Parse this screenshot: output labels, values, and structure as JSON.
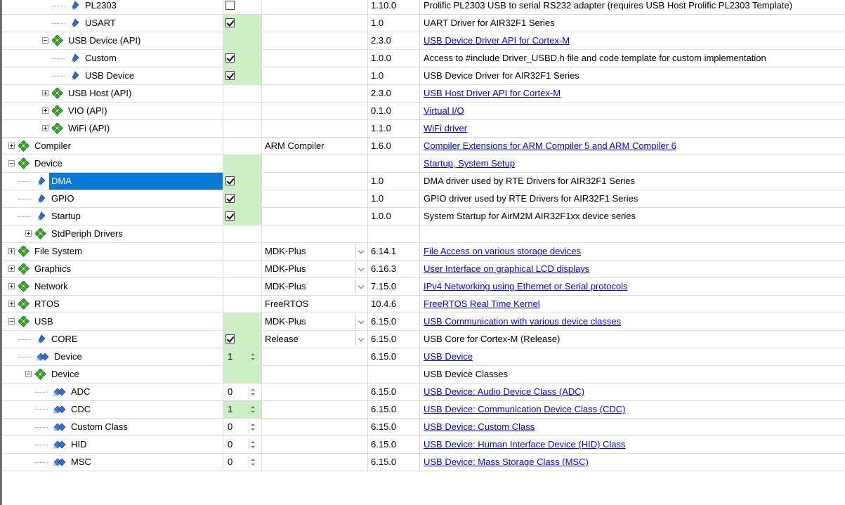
{
  "rows": [
    {
      "name": "PL2303",
      "depth": 3,
      "icon": "blue-diamond-icon",
      "sel": {
        "kind": "checkbox",
        "checked": false
      },
      "variant": "",
      "version": "1.10.0",
      "desc": "Prolific PL2303 USB to serial RS232 adapter (requires USB Host Prolific PL2303 Template)",
      "link": false
    },
    {
      "name": "USART",
      "depth": 3,
      "icon": "blue-diamond-icon",
      "sel": {
        "kind": "checkbox",
        "checked": true
      },
      "variant": "",
      "version": "1.0",
      "desc": "UART Driver for AIR32F1 Series",
      "link": false
    },
    {
      "name": "USB Device (API)",
      "depth": 2,
      "icon": "green-diamond-icon",
      "expander": "minus",
      "sel": {
        "kind": "green"
      },
      "variant": "",
      "version": "2.3.0",
      "desc": "USB Device Driver API for Cortex-M",
      "link": true
    },
    {
      "name": "Custom",
      "depth": 3,
      "icon": "blue-diamond-icon",
      "sel": {
        "kind": "checkbox",
        "checked": true
      },
      "variant": "",
      "version": "1.0.0",
      "desc": "Access to #include Driver_USBD.h file and code template for custom implementation",
      "link": false
    },
    {
      "name": "USB Device",
      "depth": 3,
      "icon": "blue-diamond-icon",
      "sel": {
        "kind": "checkbox",
        "checked": true
      },
      "variant": "",
      "version": "1.0",
      "desc": "USB Device Driver for AIR32F1 Series",
      "link": false
    },
    {
      "name": "USB Host (API)",
      "depth": 2,
      "icon": "green-diamond-icon",
      "expander": "plus",
      "sel": {
        "kind": "none"
      },
      "variant": "",
      "version": "2.3.0",
      "desc": "USB Host Driver API for Cortex-M",
      "link": true
    },
    {
      "name": "VIO (API)",
      "depth": 2,
      "icon": "green-diamond-icon",
      "expander": "plus",
      "sel": {
        "kind": "none"
      },
      "variant": "",
      "version": "0.1.0",
      "desc": "Virtual I/O",
      "link": true
    },
    {
      "name": "WiFi (API)",
      "depth": 2,
      "icon": "green-diamond-icon",
      "expander": "plus",
      "sel": {
        "kind": "none"
      },
      "variant": "",
      "version": "1.1.0",
      "desc": "WiFi driver",
      "link": true
    },
    {
      "name": "Compiler",
      "depth": 0,
      "icon": "green-diamond-icon",
      "expander": "plus",
      "sel": {
        "kind": "none"
      },
      "variant": "ARM Compiler",
      "dropdown": false,
      "version": "1.6.0",
      "desc": "Compiler Extensions for ARM Compiler 5 and ARM Compiler 6",
      "link": true
    },
    {
      "name": "Device",
      "depth": 0,
      "icon": "green-diamond-icon",
      "expander": "minus",
      "sel": {
        "kind": "green"
      },
      "variant": "",
      "version": "",
      "desc": "Startup, System Setup",
      "link": true
    },
    {
      "name": "DMA",
      "depth": 1,
      "icon": "blue-diamond-icon",
      "selected": true,
      "sel": {
        "kind": "checkbox",
        "checked": true
      },
      "variant": "",
      "version": "1.0",
      "desc": "DMA driver used by RTE Drivers for AIR32F1 Series",
      "link": false
    },
    {
      "name": "GPIO",
      "depth": 1,
      "icon": "blue-diamond-icon",
      "sel": {
        "kind": "checkbox",
        "checked": true
      },
      "variant": "",
      "version": "1.0",
      "desc": "GPIO driver used by RTE Drivers for AIR32F1 Series",
      "link": false
    },
    {
      "name": "Startup",
      "depth": 1,
      "icon": "blue-diamond-icon",
      "sel": {
        "kind": "checkbox",
        "checked": true
      },
      "variant": "",
      "version": "1.0.0",
      "desc": "System Startup for AirM2M AIR32F1xx device series",
      "link": false
    },
    {
      "name": "StdPeriph Drivers",
      "depth": 1,
      "icon": "green-diamond-icon",
      "expander": "plus",
      "sel": {
        "kind": "none"
      },
      "variant": "",
      "version": "",
      "desc": "",
      "link": false
    },
    {
      "name": "File System",
      "depth": 0,
      "icon": "green-diamond-icon",
      "expander": "plus",
      "sel": {
        "kind": "none"
      },
      "variant": "MDK-Plus",
      "dropdown": true,
      "version": "6.14.1",
      "desc": "File Access on various storage devices",
      "link": true
    },
    {
      "name": "Graphics",
      "depth": 0,
      "icon": "green-diamond-icon",
      "expander": "plus",
      "sel": {
        "kind": "none"
      },
      "variant": "MDK-Plus",
      "dropdown": true,
      "version": "6.16.3",
      "desc": "User Interface on graphical LCD displays",
      "link": true
    },
    {
      "name": "Network",
      "depth": 0,
      "icon": "green-diamond-icon",
      "expander": "plus",
      "sel": {
        "kind": "none"
      },
      "variant": "MDK-Plus",
      "dropdown": true,
      "version": "7.15.0",
      "desc": "IPv4 Networking using Ethernet or Serial protocols",
      "link": true
    },
    {
      "name": "RTOS",
      "depth": 0,
      "icon": "green-diamond-icon",
      "expander": "plus",
      "sel": {
        "kind": "none"
      },
      "variant": "FreeRTOS",
      "dropdown": false,
      "version": "10.4.6",
      "desc": "FreeRTOS Real Time Kernel",
      "link": true
    },
    {
      "name": "USB",
      "depth": 0,
      "icon": "green-diamond-icon",
      "expander": "minus",
      "sel": {
        "kind": "green"
      },
      "variant": "MDK-Plus",
      "dropdown": true,
      "version": "6.15.0",
      "desc": "USB Communication with various device classes",
      "link": true
    },
    {
      "name": "CORE",
      "depth": 1,
      "icon": "blue-diamond-icon",
      "sel": {
        "kind": "checkbox",
        "checked": true
      },
      "variant": "Release",
      "dropdown": true,
      "version": "6.15.0",
      "desc": "USB Core for Cortex-M (Release)",
      "link": false
    },
    {
      "name": "Device",
      "depth": 1,
      "icon": "multi-diamond-icon",
      "sel": {
        "kind": "spin",
        "value": "1",
        "green": true
      },
      "variant": "",
      "version": "6.15.0",
      "desc": "USB Device",
      "link": true
    },
    {
      "name": "Device",
      "depth": 1,
      "icon": "green-diamond-icon",
      "expander": "minus",
      "sel": {
        "kind": "green"
      },
      "variant": "",
      "version": "",
      "desc": "USB Device Classes",
      "link": false
    },
    {
      "name": "ADC",
      "depth": 2,
      "icon": "multi-diamond-icon",
      "sel": {
        "kind": "spin",
        "value": "0",
        "green": false
      },
      "variant": "",
      "version": "6.15.0",
      "desc": "USB Device: Audio Device Class (ADC)",
      "link": true
    },
    {
      "name": "CDC",
      "depth": 2,
      "icon": "multi-diamond-icon",
      "sel": {
        "kind": "spin",
        "value": "1",
        "green": true
      },
      "variant": "",
      "version": "6.15.0",
      "desc": "USB Device: Communication Device Class (CDC)",
      "link": true
    },
    {
      "name": "Custom Class",
      "depth": 2,
      "icon": "multi-diamond-icon",
      "sel": {
        "kind": "spin",
        "value": "0",
        "green": false
      },
      "variant": "",
      "version": "6.15.0",
      "desc": "USB Device: Custom Class",
      "link": true
    },
    {
      "name": "HID",
      "depth": 2,
      "icon": "multi-diamond-icon",
      "sel": {
        "kind": "spin",
        "value": "0",
        "green": false
      },
      "variant": "",
      "version": "6.15.0",
      "desc": "USB Device: Human Interface Device (HID) Class",
      "link": true
    },
    {
      "name": "MSC",
      "depth": 2,
      "icon": "multi-diamond-icon",
      "sel": {
        "kind": "spin",
        "value": "0",
        "green": false
      },
      "variant": "",
      "version": "6.15.0",
      "desc": "USB Device: Mass Storage Class (MSC)",
      "link": true
    }
  ]
}
